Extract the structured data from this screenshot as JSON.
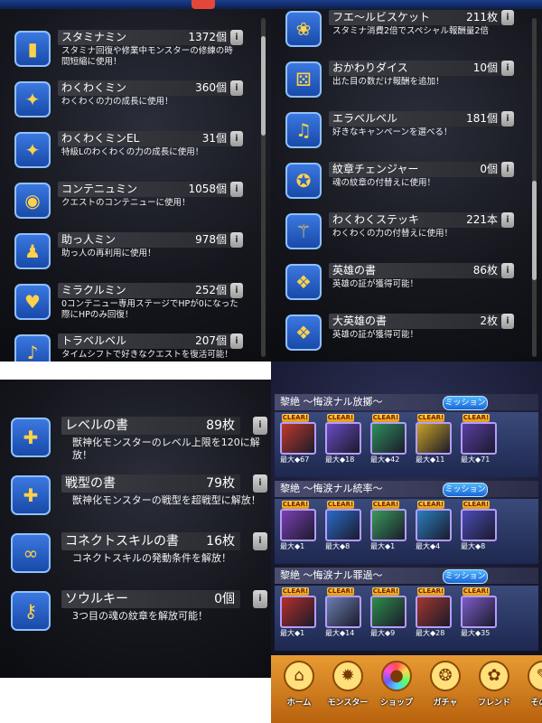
{
  "panel_top_left": {
    "items": [
      {
        "name": "スタミナミン",
        "count": "1372個",
        "desc": "スタミナ回復や修業中モンスターの修練の時間短縮に使用！",
        "icon": "stamina-can-icon",
        "glyph": "▮"
      },
      {
        "name": "わくわくミン",
        "count": "360個",
        "desc": "わくわくの力の成長に使用！",
        "icon": "waku-bottle-icon",
        "glyph": "✦"
      },
      {
        "name": "わくわくミンEL",
        "count": "31個",
        "desc": "特級Lのわくわくの力の成長に使用！",
        "icon": "waku-el-bottle-icon",
        "glyph": "✦"
      },
      {
        "name": "コンテニュミン",
        "count": "1058個",
        "desc": "クエストのコンテニューに使用！",
        "icon": "continue-flask-icon",
        "glyph": "◉"
      },
      {
        "name": "助っ人ミン",
        "count": "978個",
        "desc": "助っ人の再利用に使用！",
        "icon": "helper-figure-icon",
        "glyph": "♟"
      },
      {
        "name": "ミラクルミン",
        "count": "252個",
        "desc": "0コンテニュー専用ステージでHPが0になった際にHPのみ回復！",
        "icon": "miracle-heart-icon",
        "glyph": "♥"
      },
      {
        "name": "トラベルベル",
        "count": "207個",
        "desc": "タイムシフトで好きなクエストを復活可能！",
        "icon": "travel-bell-icon",
        "glyph": "♪"
      }
    ]
  },
  "panel_top_right": {
    "items": [
      {
        "name": "フエ～ルビスケット",
        "count": "211枚",
        "desc": "スタミナ消費2倍でスペシャル報酬量2倍",
        "icon": "biscuit-icon",
        "glyph": "❀"
      },
      {
        "name": "おかわりダイス",
        "count": "10個",
        "desc": "出た目の数だけ報酬を追加！",
        "icon": "dice-icon",
        "glyph": "⚄"
      },
      {
        "name": "エラベルベル",
        "count": "181個",
        "desc": "好きなキャンペーンを選べる！",
        "icon": "bell-icon",
        "glyph": "♫"
      },
      {
        "name": "紋章チェンジャー",
        "count": "0個",
        "desc": "魂の紋章の付替えに使用！",
        "icon": "emblem-changer-icon",
        "glyph": "✪"
      },
      {
        "name": "わくわくステッキ",
        "count": "221本",
        "desc": "わくわくの力の付替えに使用！",
        "icon": "waku-stick-icon",
        "glyph": "⚚"
      },
      {
        "name": "英雄の書",
        "count": "86枚",
        "desc": "英雄の証が獲得可能！",
        "icon": "hero-book-icon",
        "glyph": "❖"
      },
      {
        "name": "大英雄の書",
        "count": "2枚",
        "desc": "英雄の証が獲得可能！",
        "icon": "great-hero-book-icon",
        "glyph": "❖"
      }
    ]
  },
  "panel_bottom_left": {
    "items": [
      {
        "name": "レベルの書",
        "count": "89枚",
        "desc": "獣神化モンスターのレベル上限を120に解放！",
        "icon": "level-book-icon",
        "glyph": "✚"
      },
      {
        "name": "戦型の書",
        "count": "79枚",
        "desc": "獣神化モンスターの戦型を超戦型に解放！",
        "icon": "battle-type-book-icon",
        "glyph": "✚"
      },
      {
        "name": "コネクトスキルの書",
        "count": "16枚",
        "desc": "コネクトスキルの発動条件を解放！",
        "icon": "connect-skill-book-icon",
        "glyph": "∞"
      },
      {
        "name": "ソウルキー",
        "count": "0個",
        "desc": "3つ目の魂の紋章を解放可能！",
        "icon": "soul-key-icon",
        "glyph": "⚷"
      }
    ]
  },
  "panel_quests": {
    "mission_label": "ミッション",
    "clear_label": "CLEAR!",
    "quests": [
      {
        "title": "黎絶 ～悔涙ナル放擲～",
        "levels": [
          "最大◆67",
          "最大◆18",
          "最大◆42",
          "最大◆11",
          "最大◆71"
        ]
      },
      {
        "title": "黎絶 ～悔涙ナル統率～",
        "levels": [
          "最大◆1",
          "最大◆8",
          "最大◆1",
          "最大◆4",
          "最大◆8"
        ]
      },
      {
        "title": "黎絶 ～悔涙ナル罪過～",
        "levels": [
          "最大◆1",
          "最大◆14",
          "最大◆9",
          "最大◆28",
          "最大◆35"
        ]
      }
    ],
    "nav": [
      {
        "label": "ホーム",
        "icon": "home-icon",
        "glyph": "⌂"
      },
      {
        "label": "モンスター",
        "icon": "monster-icon",
        "glyph": "✹"
      },
      {
        "label": "ショップ",
        "icon": "shop-orb-icon",
        "glyph": "●"
      },
      {
        "label": "ガチャ",
        "icon": "gacha-icon",
        "glyph": "❂"
      },
      {
        "label": "フレンド",
        "icon": "friend-icon",
        "glyph": "✿"
      },
      {
        "label": "その他",
        "icon": "other-icon",
        "glyph": "✎"
      }
    ]
  },
  "colors": {
    "panel_dark": "#16171e",
    "frame_blue": "#3c78e0",
    "name_bar": "#3c3d44",
    "nav_orange": "#e89b32",
    "clear_gold": "#ffd64f"
  }
}
